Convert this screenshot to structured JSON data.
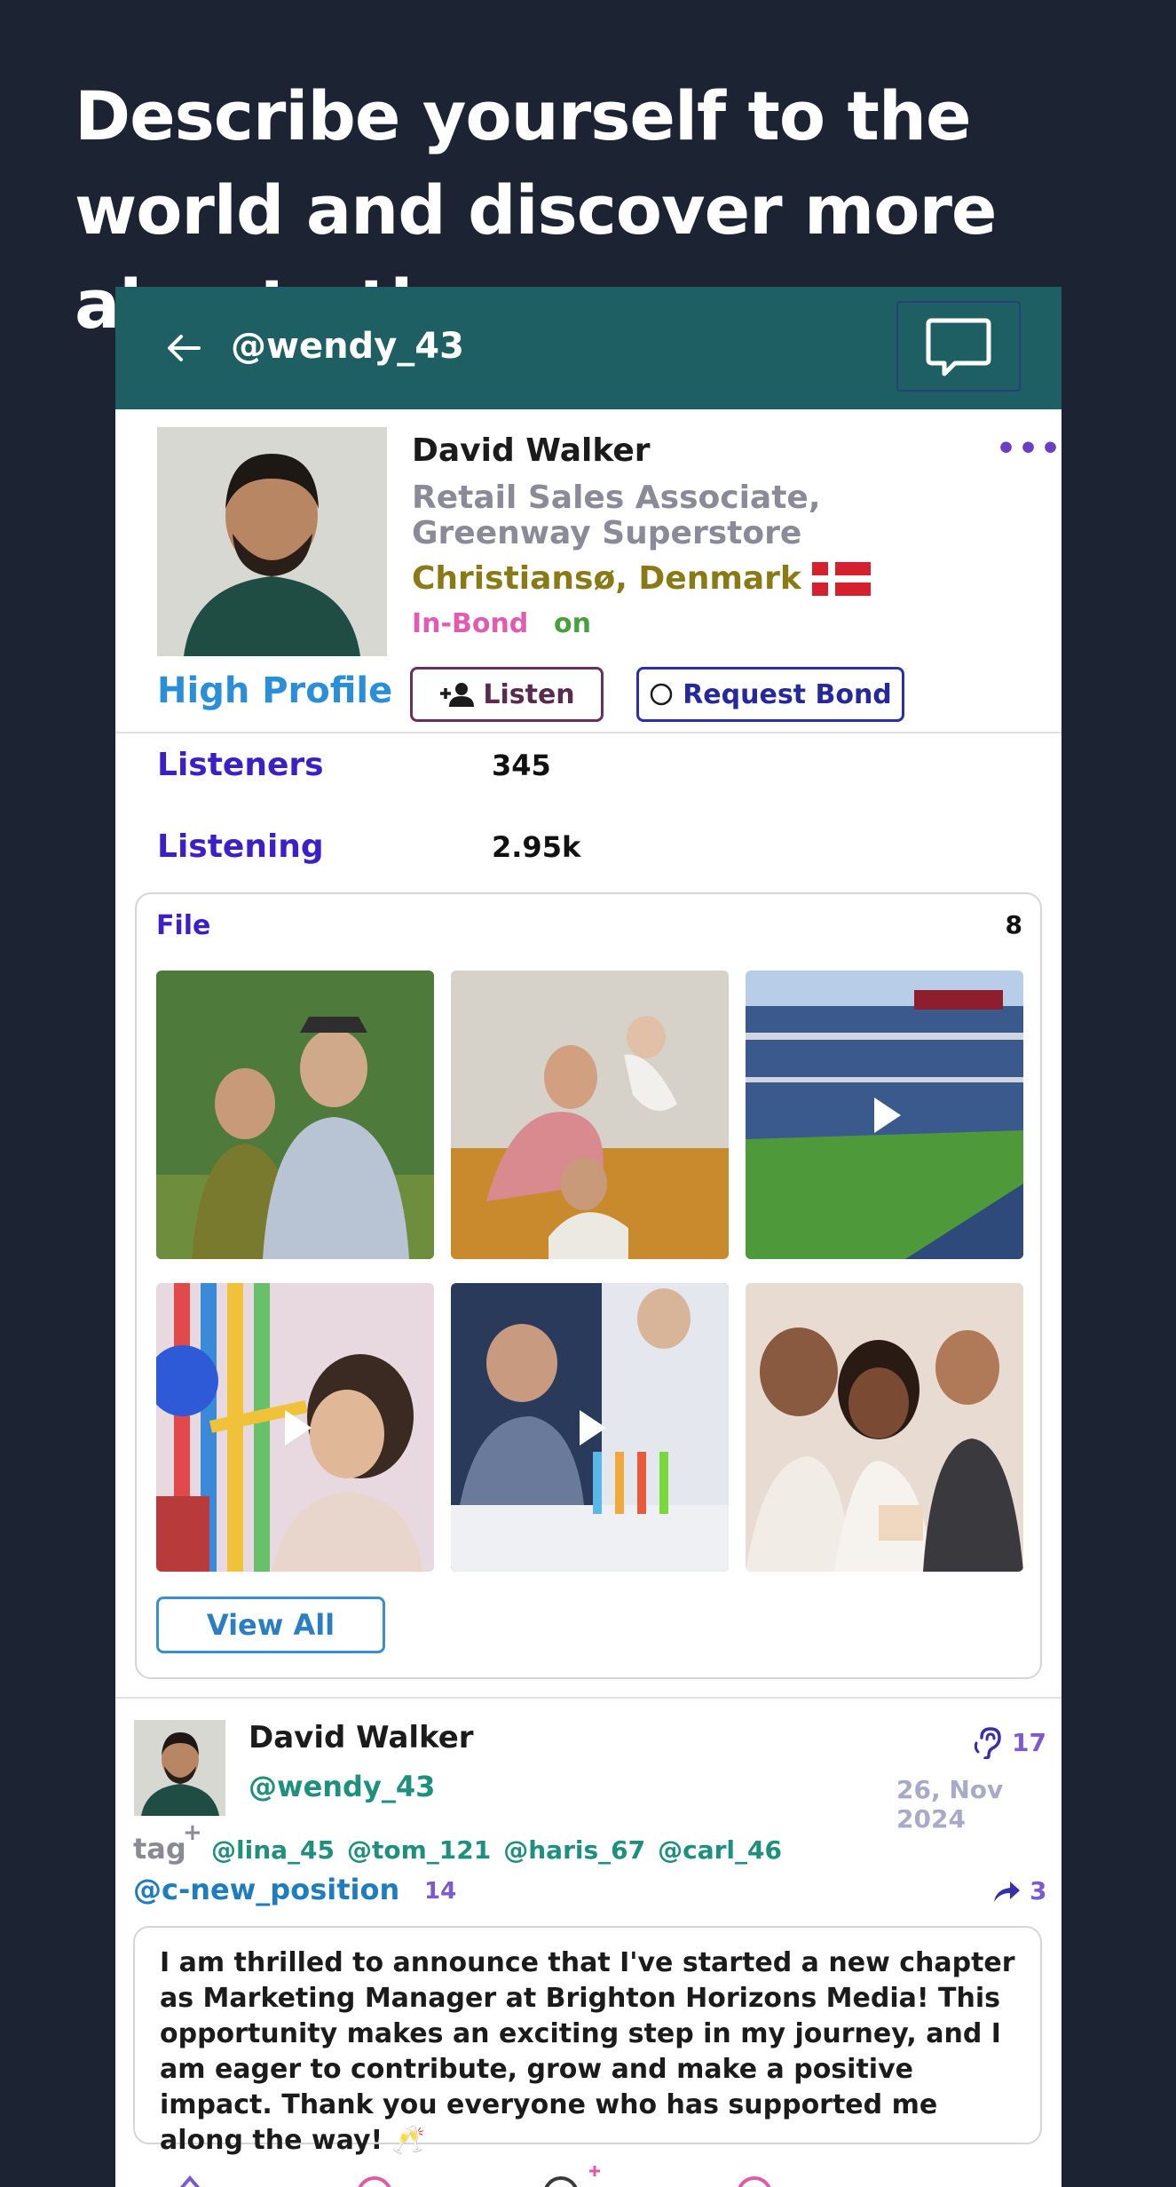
{
  "headline": "Describe yourself to the world and discover more about others",
  "topbar": {
    "handle": "@wendy_43"
  },
  "profile": {
    "name": "David Walker",
    "role": "Retail Sales Associate, Greenway Superstore",
    "location": "Christiansø, Denmark",
    "bond_status": "In-Bond",
    "bond_state": "on",
    "tier": "High Profile",
    "listen_button": "Listen",
    "bond_button": "Request Bond",
    "more_icon": "more-dots-icon"
  },
  "stats": {
    "listeners_label": "Listeners",
    "listeners_value": "345",
    "listening_label": "Listening",
    "listening_value": "2.95k"
  },
  "files": {
    "title": "File",
    "count": "8",
    "view_all": "View All",
    "items": [
      {
        "kind": "photo",
        "palette": [
          "#5e8a4a",
          "#3a5a2e"
        ]
      },
      {
        "kind": "photo",
        "palette": [
          "#d9c8b8",
          "#c78a3a"
        ]
      },
      {
        "kind": "video",
        "palette": [
          "#7a98c8",
          "#4a8a3a"
        ]
      },
      {
        "kind": "video",
        "palette": [
          "#e0a8c8",
          "#3a7ad8"
        ]
      },
      {
        "kind": "video",
        "palette": [
          "#6a8ab8",
          "#e8e8ee"
        ]
      },
      {
        "kind": "photo",
        "palette": [
          "#c8b8a8",
          "#7a4a3a"
        ]
      }
    ]
  },
  "post": {
    "name": "David Walker",
    "handle": "@wendy_43",
    "listen_count": "17",
    "date": "26, Nov 2024",
    "tag_word": "tag",
    "tags": [
      "@lina_45",
      "@tom_121",
      "@haris_67",
      "@carl_46"
    ],
    "channel": "@c-new_position",
    "channel_count": "14",
    "share_count": "3",
    "body": "I am thrilled to announce that I've started a new chapter as Marketing Manager at Brighton Horizons Media! This opportunity makes an exciting step in my journey, and I am eager to contribute, grow and make a positive impact. Thank you everyone who has supported me along the way! 🥂"
  },
  "colors": {
    "background": "#1c2333",
    "topbar": "#1e5f64",
    "accent_purple": "#3d1fc8",
    "teal_handle": "#1f8f7e"
  }
}
